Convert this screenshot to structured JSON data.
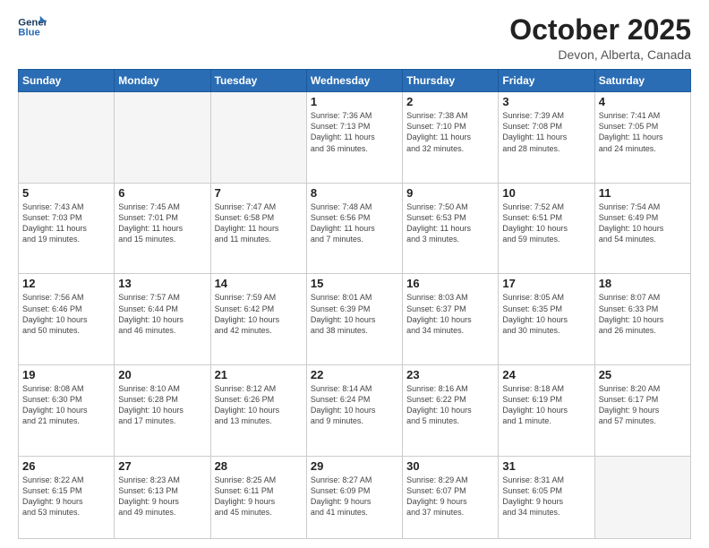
{
  "header": {
    "logo_line1": "General",
    "logo_line2": "Blue",
    "month": "October 2025",
    "location": "Devon, Alberta, Canada"
  },
  "weekdays": [
    "Sunday",
    "Monday",
    "Tuesday",
    "Wednesday",
    "Thursday",
    "Friday",
    "Saturday"
  ],
  "weeks": [
    [
      {
        "day": "",
        "info": ""
      },
      {
        "day": "",
        "info": ""
      },
      {
        "day": "",
        "info": ""
      },
      {
        "day": "1",
        "info": "Sunrise: 7:36 AM\nSunset: 7:13 PM\nDaylight: 11 hours\nand 36 minutes."
      },
      {
        "day": "2",
        "info": "Sunrise: 7:38 AM\nSunset: 7:10 PM\nDaylight: 11 hours\nand 32 minutes."
      },
      {
        "day": "3",
        "info": "Sunrise: 7:39 AM\nSunset: 7:08 PM\nDaylight: 11 hours\nand 28 minutes."
      },
      {
        "day": "4",
        "info": "Sunrise: 7:41 AM\nSunset: 7:05 PM\nDaylight: 11 hours\nand 24 minutes."
      }
    ],
    [
      {
        "day": "5",
        "info": "Sunrise: 7:43 AM\nSunset: 7:03 PM\nDaylight: 11 hours\nand 19 minutes."
      },
      {
        "day": "6",
        "info": "Sunrise: 7:45 AM\nSunset: 7:01 PM\nDaylight: 11 hours\nand 15 minutes."
      },
      {
        "day": "7",
        "info": "Sunrise: 7:47 AM\nSunset: 6:58 PM\nDaylight: 11 hours\nand 11 minutes."
      },
      {
        "day": "8",
        "info": "Sunrise: 7:48 AM\nSunset: 6:56 PM\nDaylight: 11 hours\nand 7 minutes."
      },
      {
        "day": "9",
        "info": "Sunrise: 7:50 AM\nSunset: 6:53 PM\nDaylight: 11 hours\nand 3 minutes."
      },
      {
        "day": "10",
        "info": "Sunrise: 7:52 AM\nSunset: 6:51 PM\nDaylight: 10 hours\nand 59 minutes."
      },
      {
        "day": "11",
        "info": "Sunrise: 7:54 AM\nSunset: 6:49 PM\nDaylight: 10 hours\nand 54 minutes."
      }
    ],
    [
      {
        "day": "12",
        "info": "Sunrise: 7:56 AM\nSunset: 6:46 PM\nDaylight: 10 hours\nand 50 minutes."
      },
      {
        "day": "13",
        "info": "Sunrise: 7:57 AM\nSunset: 6:44 PM\nDaylight: 10 hours\nand 46 minutes."
      },
      {
        "day": "14",
        "info": "Sunrise: 7:59 AM\nSunset: 6:42 PM\nDaylight: 10 hours\nand 42 minutes."
      },
      {
        "day": "15",
        "info": "Sunrise: 8:01 AM\nSunset: 6:39 PM\nDaylight: 10 hours\nand 38 minutes."
      },
      {
        "day": "16",
        "info": "Sunrise: 8:03 AM\nSunset: 6:37 PM\nDaylight: 10 hours\nand 34 minutes."
      },
      {
        "day": "17",
        "info": "Sunrise: 8:05 AM\nSunset: 6:35 PM\nDaylight: 10 hours\nand 30 minutes."
      },
      {
        "day": "18",
        "info": "Sunrise: 8:07 AM\nSunset: 6:33 PM\nDaylight: 10 hours\nand 26 minutes."
      }
    ],
    [
      {
        "day": "19",
        "info": "Sunrise: 8:08 AM\nSunset: 6:30 PM\nDaylight: 10 hours\nand 21 minutes."
      },
      {
        "day": "20",
        "info": "Sunrise: 8:10 AM\nSunset: 6:28 PM\nDaylight: 10 hours\nand 17 minutes."
      },
      {
        "day": "21",
        "info": "Sunrise: 8:12 AM\nSunset: 6:26 PM\nDaylight: 10 hours\nand 13 minutes."
      },
      {
        "day": "22",
        "info": "Sunrise: 8:14 AM\nSunset: 6:24 PM\nDaylight: 10 hours\nand 9 minutes."
      },
      {
        "day": "23",
        "info": "Sunrise: 8:16 AM\nSunset: 6:22 PM\nDaylight: 10 hours\nand 5 minutes."
      },
      {
        "day": "24",
        "info": "Sunrise: 8:18 AM\nSunset: 6:19 PM\nDaylight: 10 hours\nand 1 minute."
      },
      {
        "day": "25",
        "info": "Sunrise: 8:20 AM\nSunset: 6:17 PM\nDaylight: 9 hours\nand 57 minutes."
      }
    ],
    [
      {
        "day": "26",
        "info": "Sunrise: 8:22 AM\nSunset: 6:15 PM\nDaylight: 9 hours\nand 53 minutes."
      },
      {
        "day": "27",
        "info": "Sunrise: 8:23 AM\nSunset: 6:13 PM\nDaylight: 9 hours\nand 49 minutes."
      },
      {
        "day": "28",
        "info": "Sunrise: 8:25 AM\nSunset: 6:11 PM\nDaylight: 9 hours\nand 45 minutes."
      },
      {
        "day": "29",
        "info": "Sunrise: 8:27 AM\nSunset: 6:09 PM\nDaylight: 9 hours\nand 41 minutes."
      },
      {
        "day": "30",
        "info": "Sunrise: 8:29 AM\nSunset: 6:07 PM\nDaylight: 9 hours\nand 37 minutes."
      },
      {
        "day": "31",
        "info": "Sunrise: 8:31 AM\nSunset: 6:05 PM\nDaylight: 9 hours\nand 34 minutes."
      },
      {
        "day": "",
        "info": ""
      }
    ]
  ]
}
